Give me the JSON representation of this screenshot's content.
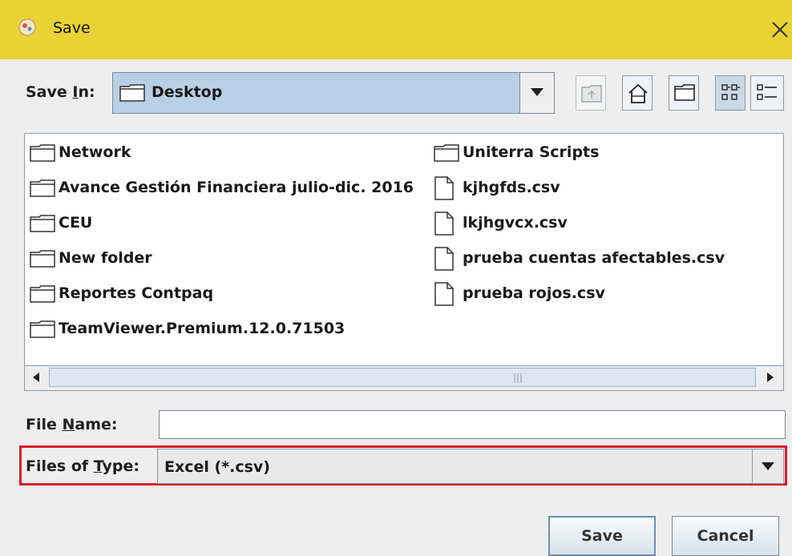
{
  "window": {
    "title": "Save",
    "close_glyph": "✕",
    "accent_color": "#e8d234"
  },
  "save_in": {
    "label_prefix": "Save ",
    "label_mnemonic": "I",
    "label_suffix": "n:",
    "selected": "Desktop"
  },
  "toolbar": {
    "buttons": [
      {
        "name": "up-one-level-button",
        "icon": "up-folder-icon",
        "enabled": false
      },
      {
        "name": "home-button",
        "icon": "home-icon",
        "enabled": true
      },
      {
        "name": "new-folder-button",
        "icon": "new-folder-icon",
        "enabled": true
      },
      {
        "name": "list-view-button",
        "icon": "list-view-icon",
        "selected": true
      },
      {
        "name": "details-view-button",
        "icon": "details-view-icon",
        "selected": false
      }
    ]
  },
  "files": {
    "left": [
      {
        "name": "Network",
        "type": "folder"
      },
      {
        "name": "Avance Gestión Financiera julio-dic. 2016",
        "type": "folder"
      },
      {
        "name": "CEU",
        "type": "folder"
      },
      {
        "name": "New folder",
        "type": "folder"
      },
      {
        "name": "Reportes Contpaq",
        "type": "folder"
      },
      {
        "name": "TeamViewer.Premium.12.0.71503",
        "type": "folder"
      }
    ],
    "right": [
      {
        "name": "Uniterra Scripts",
        "type": "folder"
      },
      {
        "name": "kjhgfds.csv",
        "type": "file"
      },
      {
        "name": "lkjhgvcx.csv",
        "type": "file"
      },
      {
        "name": "prueba cuentas afectables.csv",
        "type": "file"
      },
      {
        "name": "prueba rojos.csv",
        "type": "file"
      }
    ]
  },
  "file_name": {
    "label_prefix": "File ",
    "label_mnemonic": "N",
    "label_suffix": "ame:",
    "value": ""
  },
  "file_type": {
    "label_prefix": "Files of ",
    "label_mnemonic": "T",
    "label_suffix": "ype:",
    "selected": "Excel (*.csv)",
    "highlight_color": "#d7182a"
  },
  "actions": {
    "save_label": "Save",
    "cancel_label": "Cancel"
  }
}
